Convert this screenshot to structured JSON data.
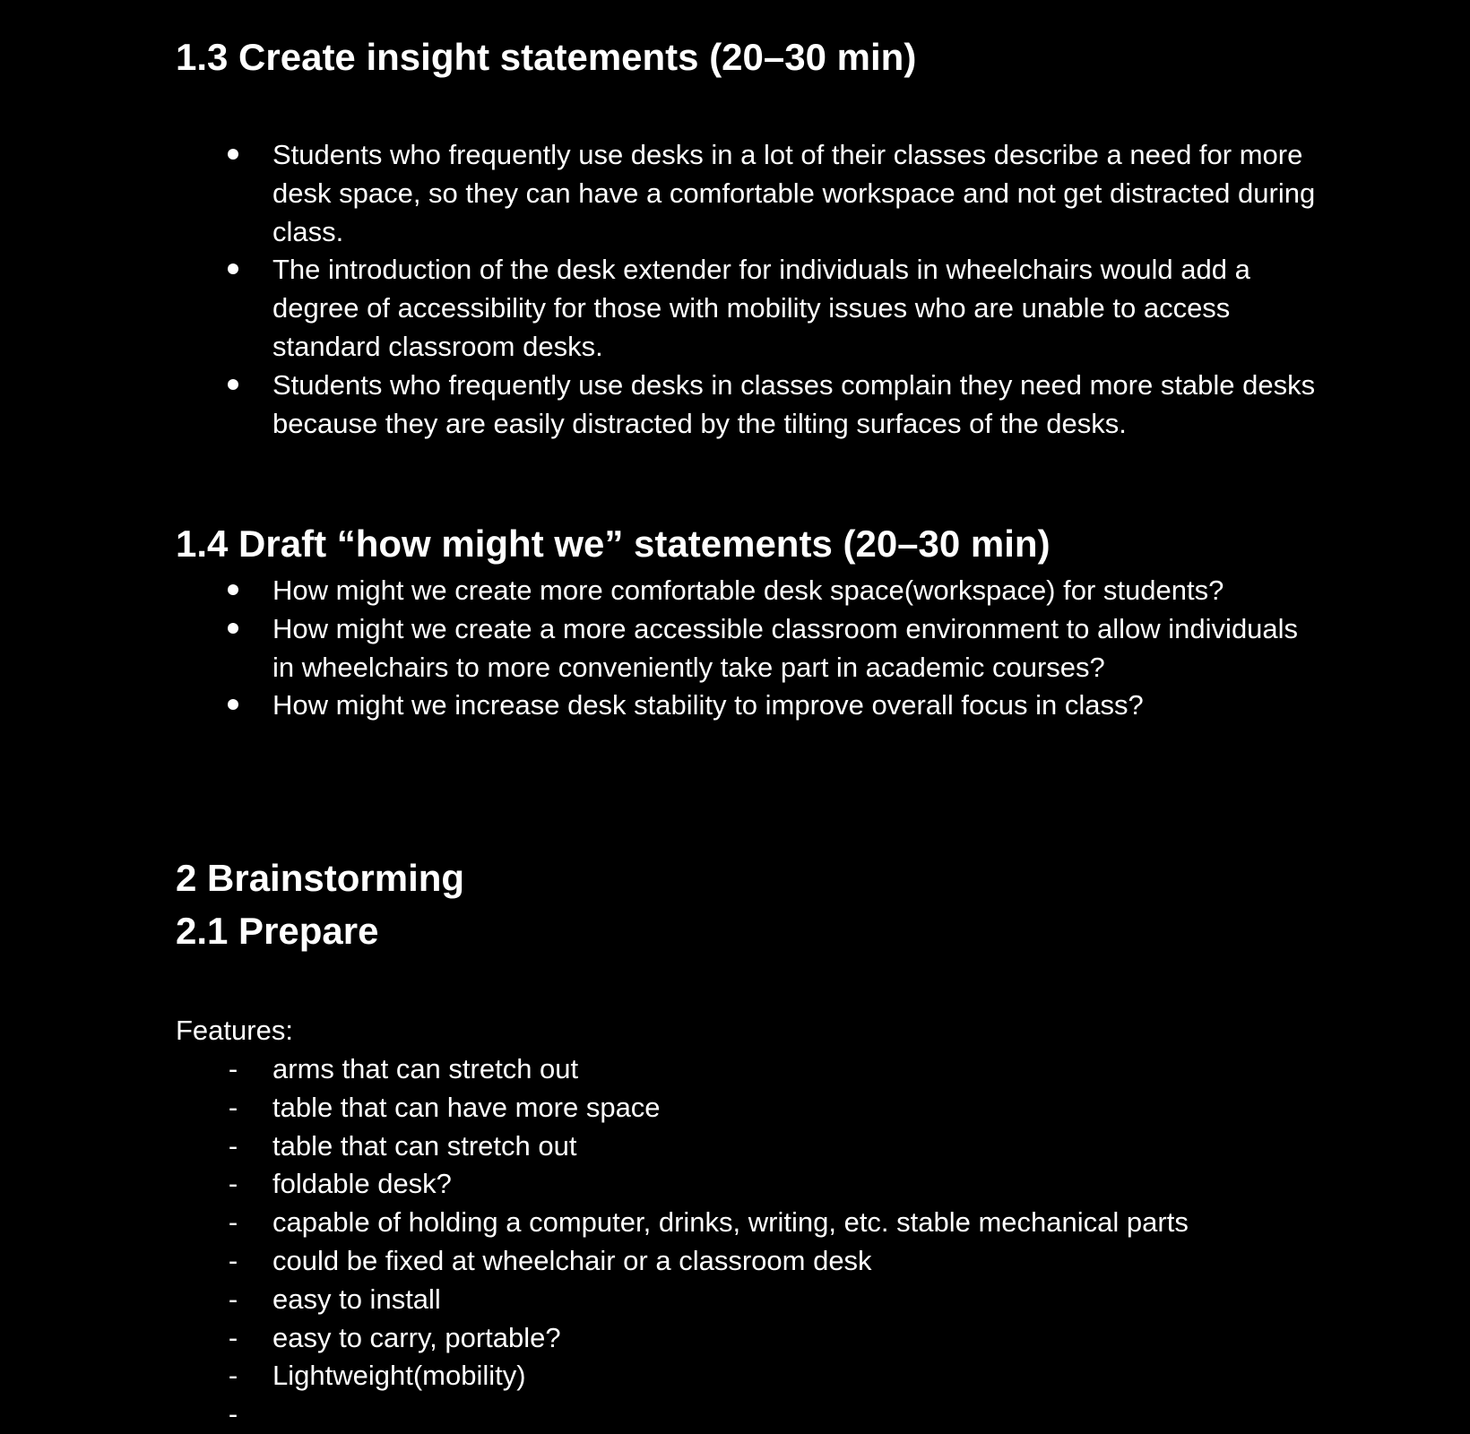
{
  "section_1_3": {
    "heading": "1.3 Create insight statements (20–30 min)",
    "items": [
      "Students who frequently use desks in a lot of their classes describe a need for more desk space, so they can have a comfortable workspace and not get distracted during class.",
      "The introduction of the desk extender for individuals in wheelchairs would add a degree of accessibility for those with mobility issues who are unable to access standard classroom desks.",
      "Students who frequently use desks in classes complain they need more stable desks because they are easily distracted by the tilting surfaces of the desks."
    ]
  },
  "section_1_4": {
    "heading": "1.4 Draft “how might we” statements (20–30 min)",
    "items": [
      "How might we create more comfortable desk space(workspace) for students?",
      "How might we create a more accessible classroom environment to allow individuals in wheelchairs to more conveniently take part in academic courses?",
      "How might we increase desk stability to improve overall focus in class?"
    ]
  },
  "section_2": {
    "heading": "2 Brainstorming",
    "subheading": "2.1 Prepare",
    "features_label": "Features:",
    "dash_marker": "-",
    "features": [
      "arms that can stretch out",
      "table that can have more space",
      "table that can stretch out",
      "foldable desk?",
      "capable of holding a computer, drinks, writing, etc. stable mechanical parts",
      "could be fixed at wheelchair or a classroom desk",
      "easy to install",
      "easy to carry, portable?",
      "Lightweight(mobility)",
      ""
    ]
  }
}
